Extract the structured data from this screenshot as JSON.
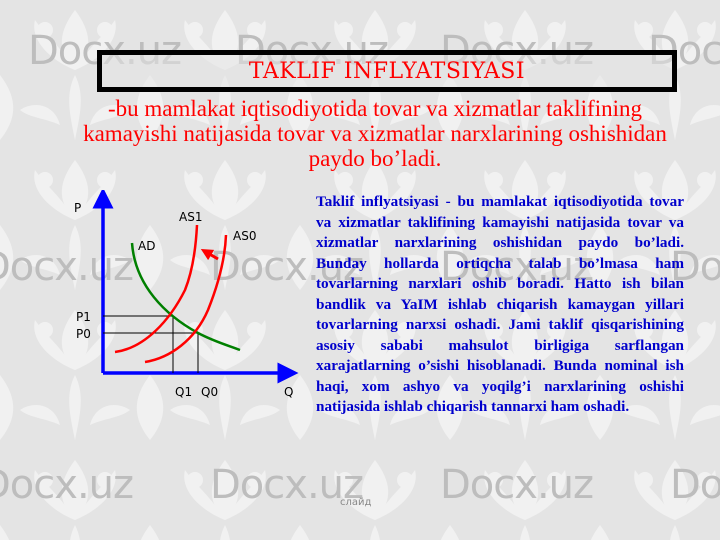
{
  "slide": {
    "title": "TAKLIF INFLYATSIYASI",
    "subtitle": "-bu mamlakat iqtisodiyotida tovar va xizmatlar taklifining kamayishi natijasida tovar va xizmatlar narxlarining oshishidan paydo bo’ladi.",
    "body": "Taklif inflyatsiyasi - bu mamlakat iqtisodiyotida tovar va xizmatlar taklifining kamayishi natijasida tovar va xizmatlar narxlarining oshishidan paydo bo’ladi. Bunday hollarda ortiqcha talab bo’lmasa ham tovarlarning narxlari oshib boradi. Hatto ish bilan bandlik va YaIM ishlab chiqarish kamaygan yillari tovarlarning narxsi oshadi. Jami taklif qisqarishining asosiy sababi mahsulot birligiga sarflangan xarajatlarning o’sishi hisoblanadi. Bunda nominal ish haqi, xom ashyo va yoqilg’i narxlarining oshishi natijasida ishlab chiqarish tannarxi ham oshadi.",
    "slide_label": "слайд",
    "watermark": "Docx.uz"
  },
  "colors": {
    "title": "#ff0000",
    "subtitle": "#ff0000",
    "body": "#0000cc",
    "axis": "#0000ff",
    "supply": "#ff0000",
    "demand": "#008000"
  },
  "diagram": {
    "type": "supply-demand",
    "axes": {
      "y_label": "P",
      "x_label": "Q"
    },
    "curves": [
      {
        "name": "AD",
        "label": "AD",
        "kind": "demand"
      },
      {
        "name": "AS1",
        "label": "AS1",
        "kind": "supply"
      },
      {
        "name": "AS0",
        "label": "AS0",
        "kind": "supply"
      }
    ],
    "shift_arrow": {
      "from": "AS0",
      "to": "AS1"
    },
    "price_labels": [
      "P1",
      "P0"
    ],
    "quantity_labels": [
      "Q1",
      "Q0"
    ]
  }
}
